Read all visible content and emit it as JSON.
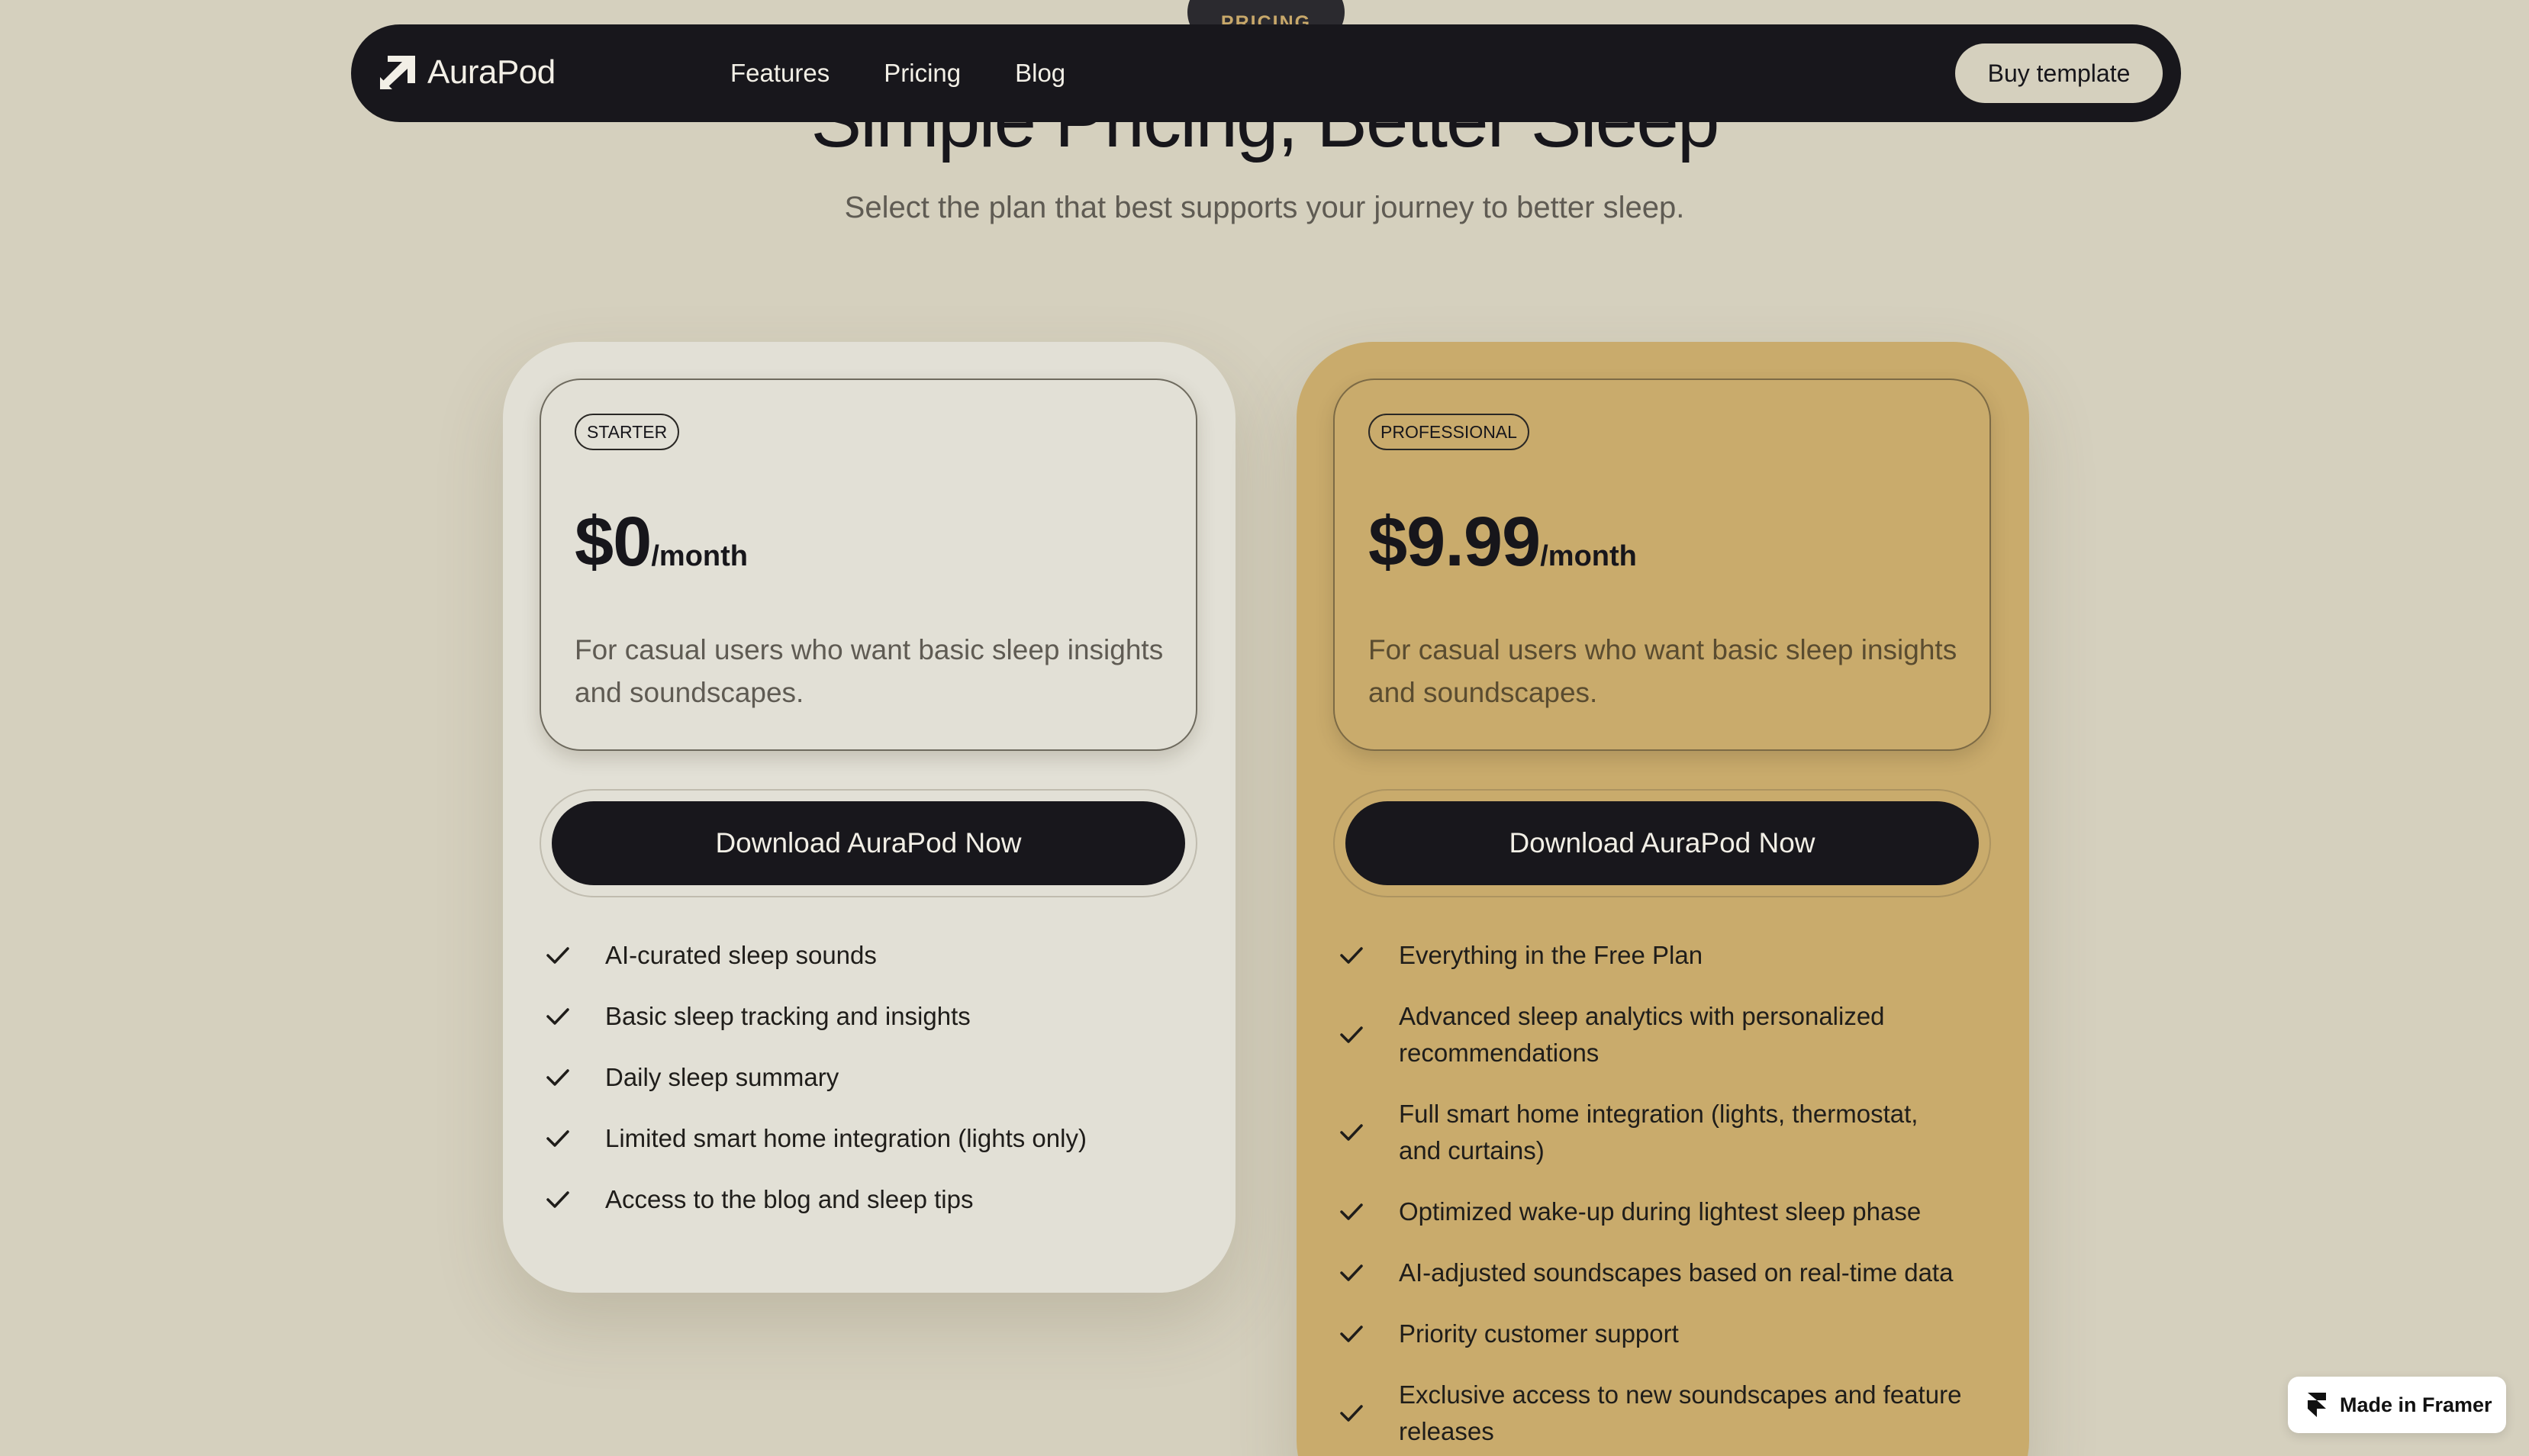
{
  "section_label": "PRICING",
  "hero": {
    "title": "Simple Pricing, Better Sleep",
    "subtitle": "Select the plan that best supports your journey to better sleep."
  },
  "nav": {
    "brand": "AuraPod",
    "links": [
      "Features",
      "Pricing",
      "Blog"
    ],
    "cta_label": "Buy template"
  },
  "plans": [
    {
      "badge": "STARTER",
      "price": "$0",
      "period": "/month",
      "description": "For casual users who want basic sleep insights and soundscapes.",
      "cta_label": "Download AuraPod Now",
      "features": [
        "AI-curated sleep sounds",
        "Basic sleep tracking and insights",
        "Daily sleep summary",
        "Limited smart home integration (lights only)",
        "Access to the blog and sleep tips"
      ]
    },
    {
      "badge": "PROFESSIONAL",
      "price": "$9.99",
      "period": "/month",
      "description": "For casual users who want basic sleep insights and soundscapes.",
      "cta_label": "Download AuraPod Now",
      "features": [
        "Everything in the Free Plan",
        "Advanced sleep analytics with personalized recommendations",
        "Full smart home integration (lights, thermostat, and curtains)",
        "Optimized wake-up during lightest sleep phase",
        "AI-adjusted soundscapes based on real-time data",
        "Priority customer support",
        "Exclusive access to new soundscapes and feature releases"
      ]
    }
  ],
  "framer_badge": "Made in Framer",
  "colors": {
    "page_bg": "#d5d0be",
    "nav_bg": "#18171c",
    "starter_card": "#e2e0d6",
    "pro_card": "#c9ab6c",
    "button_dark": "#18171c"
  },
  "icons": {
    "logo": "aurapod-logo-icon",
    "feature_check": "check-icon",
    "framer": "framer-logo-icon"
  }
}
